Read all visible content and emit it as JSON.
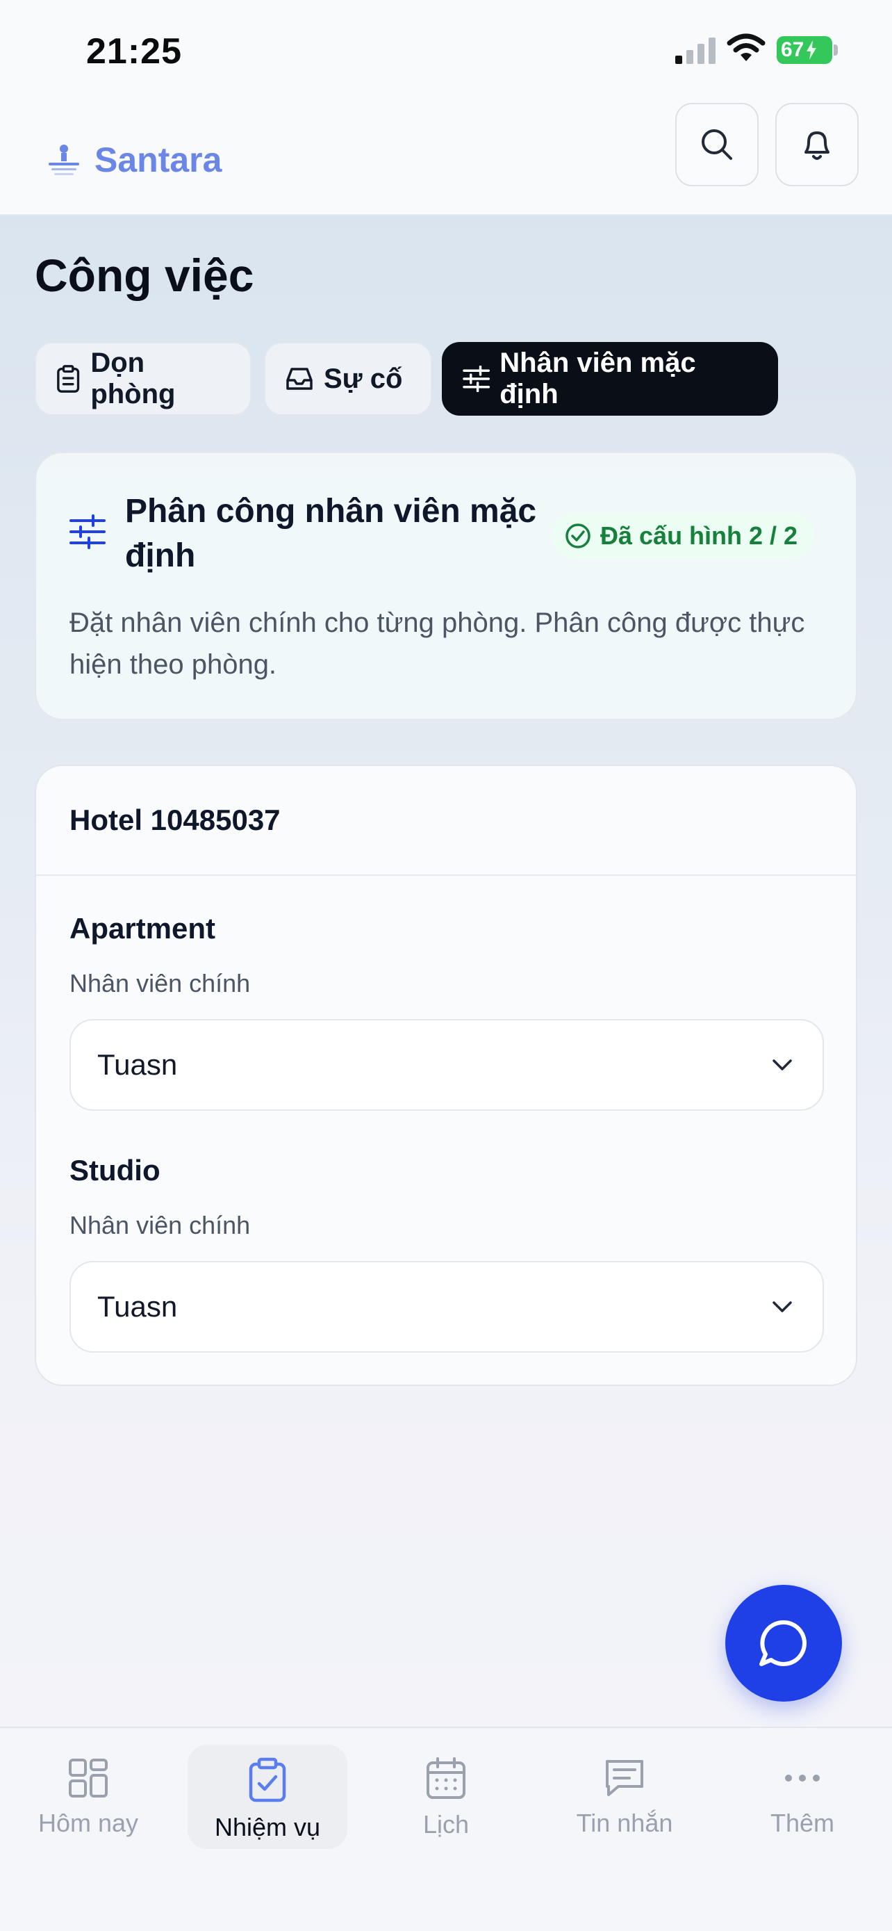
{
  "status_bar": {
    "time": "21:25",
    "battery": "67"
  },
  "header": {
    "brand": "Santara"
  },
  "page": {
    "title": "Công việc"
  },
  "tabs": [
    {
      "label": "Dọn phòng",
      "icon": "clipboard-list-icon",
      "active": false
    },
    {
      "label": "Sự cố",
      "icon": "inbox-icon",
      "active": false
    },
    {
      "label": "Nhân viên mặc định",
      "icon": "sliders-icon",
      "active": true
    }
  ],
  "info_card": {
    "title": "Phân công nhân viên mặc định",
    "badge": "Đã cấu hình 2 / 2",
    "description": "Đặt nhân viên chính cho từng phòng. Phân công được thực hiện theo phòng."
  },
  "hotel": {
    "name": "Hotel 10485037",
    "rooms": [
      {
        "name": "Apartment",
        "field_label": "Nhân viên chính",
        "value": "Tuasn"
      },
      {
        "name": "Studio",
        "field_label": "Nhân viên chính",
        "value": "Tuasn"
      }
    ]
  },
  "bottom_nav": [
    {
      "label": "Hôm nay",
      "icon": "grid-icon",
      "active": false
    },
    {
      "label": "Nhiệm vụ",
      "icon": "clipboard-check-icon",
      "active": true
    },
    {
      "label": "Lịch",
      "icon": "calendar-icon",
      "active": false
    },
    {
      "label": "Tin nhắn",
      "icon": "message-icon",
      "active": false
    },
    {
      "label": "Thêm",
      "icon": "more-icon",
      "active": false
    }
  ],
  "colors": {
    "accent": "#1e40e6",
    "brand": "#6b86e6",
    "success": "#16803c",
    "active_tab": "#0a0e17"
  }
}
